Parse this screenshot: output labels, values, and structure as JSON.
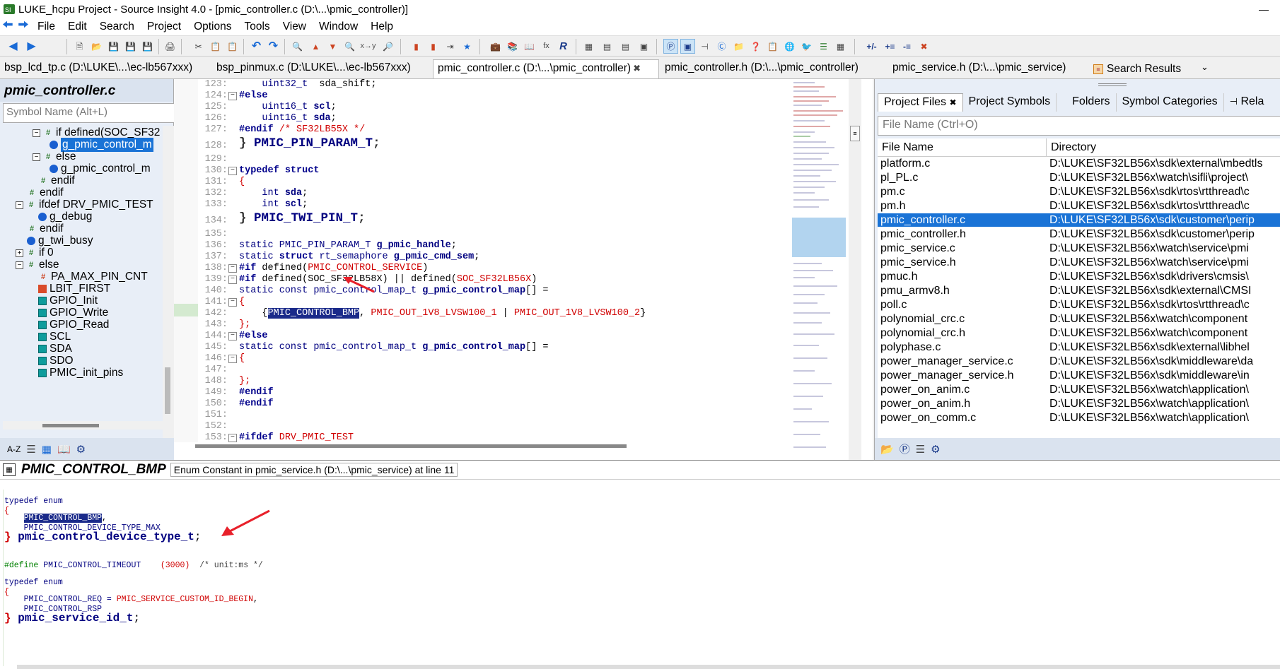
{
  "window": {
    "title": "LUKE_hcpu Project - Source Insight 4.0 - [pmic_controller.c (D:\\...\\pmic_controller)]",
    "minimize": "—"
  },
  "menu": [
    "File",
    "Edit",
    "Search",
    "Project",
    "Options",
    "Tools",
    "View",
    "Window",
    "Help"
  ],
  "file_tabs": [
    {
      "label": "bsp_lcd_tp.c (D:\\LUKE\\...\\ec-lb567xxx)"
    },
    {
      "label": "bsp_pinmux.c (D:\\LUKE\\...\\ec-lb567xxx)"
    },
    {
      "label": "pmic_controller.c (D:\\...\\pmic_controller)",
      "close": "✖"
    },
    {
      "label": "pmic_controller.h (D:\\...\\pmic_controller)"
    },
    {
      "label": "pmic_service.h (D:\\...\\pmic_service)"
    },
    {
      "label": "Search Results"
    }
  ],
  "symbol_panel": {
    "title": "pmic_controller.c",
    "search_placeholder": "Symbol Name (Alt+L)",
    "items": [
      {
        "label": "if defined(SOC_SF32"
      },
      {
        "label": "g_pmic_control_m"
      },
      {
        "label": "else"
      },
      {
        "label": "g_pmic_control_m"
      },
      {
        "label": "endif"
      },
      {
        "label": "endif"
      },
      {
        "label": "ifdef DRV_PMIC_TEST"
      },
      {
        "label": "g_debug"
      },
      {
        "label": "endif"
      },
      {
        "label": "g_twi_busy"
      },
      {
        "label": "if 0"
      },
      {
        "label": "else"
      },
      {
        "label": "PA_MAX_PIN_CNT"
      },
      {
        "label": "LBIT_FIRST"
      },
      {
        "label": "GPIO_Init"
      },
      {
        "label": "GPIO_Write"
      },
      {
        "label": "GPIO_Read"
      },
      {
        "label": "SCL"
      },
      {
        "label": "SDA"
      },
      {
        "label": "SDO"
      },
      {
        "label": "PMIC_init_pins"
      }
    ],
    "sort_label": "A-Z"
  },
  "code_lines": [
    {
      "num": "123:",
      "text": "    uint32_t  sda_shift;"
    },
    {
      "num": "124:",
      "text": "#else"
    },
    {
      "num": "125:",
      "text": "    uint16_t scl;"
    },
    {
      "num": "126:",
      "text": "    uint16_t sda;"
    },
    {
      "num": "127:",
      "text": "#endif /* SF32LB55X */"
    },
    {
      "num": "128:",
      "text": "} PMIC_PIN_PARAM_T;"
    },
    {
      "num": "129:",
      "text": ""
    },
    {
      "num": "130:",
      "text": "typedef struct"
    },
    {
      "num": "131:",
      "text": "{"
    },
    {
      "num": "132:",
      "text": "    int sda;"
    },
    {
      "num": "133:",
      "text": "    int scl;"
    },
    {
      "num": "134:",
      "text": "} PMIC_TWI_PIN_T;"
    },
    {
      "num": "135:",
      "text": ""
    },
    {
      "num": "136:",
      "text": "static PMIC_PIN_PARAM_T g_pmic_handle;"
    },
    {
      "num": "137:",
      "text": "static struct rt_semaphore g_pmic_cmd_sem;"
    },
    {
      "num": "138:",
      "text": "#if defined(PMIC_CONTROL_SERVICE)"
    },
    {
      "num": "139:",
      "text": "#if defined(SOC_SF32LB58X) || defined(SOC_SF32LB56X)"
    },
    {
      "num": "140:",
      "text": "static const pmic_control_map_t g_pmic_control_map[] ="
    },
    {
      "num": "141:",
      "text": "{"
    },
    {
      "num": "142:",
      "text": "    {PMIC_CONTROL_BMP, PMIC_OUT_1V8_LVSW100_1 | PMIC_OUT_1V8_LVSW100_2}"
    },
    {
      "num": "143:",
      "text": "};"
    },
    {
      "num": "144:",
      "text": "#else"
    },
    {
      "num": "145:",
      "text": "static const pmic_control_map_t g_pmic_control_map[] ="
    },
    {
      "num": "146:",
      "text": "{"
    },
    {
      "num": "147:",
      "text": ""
    },
    {
      "num": "148:",
      "text": "};"
    },
    {
      "num": "149:",
      "text": "#endif"
    },
    {
      "num": "150:",
      "text": "#endif"
    },
    {
      "num": "151:",
      "text": ""
    },
    {
      "num": "152:",
      "text": ""
    },
    {
      "num": "153:",
      "text": "#ifdef DRV_PMIC_TEST"
    }
  ],
  "code_tokens": {
    "l123a": "uint32_t",
    "l123b": "  sda_shift;",
    "l124": "#else",
    "l125a": "uint16_t",
    "l125b": "scl",
    "l125c": ";",
    "l126a": "uint16_t",
    "l126b": "sda",
    "l126c": ";",
    "l127a": "#endif",
    "l127b": "/* SF32LB55X */",
    "l128a": "}",
    "l128b": "PMIC_PIN_PARAM_T",
    "l128c": ";",
    "l130a": "typedef",
    "l130b": "struct",
    "l131": "{",
    "l132a": "int",
    "l132b": "sda",
    "l132c": ";",
    "l133a": "int",
    "l133b": "scl",
    "l133c": ";",
    "l134a": "}",
    "l134b": "PMIC_TWI_PIN_T",
    "l134c": ";",
    "l136a": "static",
    "l136b": "PMIC_PIN_PARAM_T",
    "l136c": "g_pmic_handle",
    "l136d": ";",
    "l137a": "static",
    "l137b": "struct",
    "l137c": "rt_semaphore",
    "l137d": "g_pmic_cmd_sem",
    "l137e": ";",
    "l138a": "#if",
    "l138b": "defined(",
    "l138c": "PMIC_CONTROL_SERVICE",
    "l138d": ")",
    "l139a": "#if",
    "l139b": "defined(SOC_SF32LB58X) || defined(",
    "l139c": "SOC_SF32LB56X",
    "l139d": ")",
    "l140a": "static const",
    "l140b": "pmic_control_map_t",
    "l140c": "g_pmic_control_map",
    "l140d": "[] =",
    "l141": "{",
    "l142a": "{",
    "l142b": "PMIC_CONTROL_BMP",
    "l142c": ", ",
    "l142d": "PMIC_OUT_1V8_LVSW100_1",
    "l142e": " | ",
    "l142f": "PMIC_OUT_1V8_LVSW100_2",
    "l142g": "}",
    "l143": "};",
    "l144": "#else",
    "l145a": "static const",
    "l145b": "pmic_control_map_t",
    "l145c": "g_pmic_control_map",
    "l145d": "[] =",
    "l146": "{",
    "l148": "};",
    "l149": "#endif",
    "l150": "#endif",
    "l153a": "#ifdef",
    "l153b": "DRV_PMIC_TEST"
  },
  "project_panel": {
    "tabs": [
      "Project Files",
      "Project Symbols",
      "Folders",
      "Symbol Categories",
      "Rela"
    ],
    "tab_close": "✖",
    "search_placeholder": "File Name (Ctrl+O)",
    "columns": [
      "File Name",
      "Directory"
    ],
    "files": [
      {
        "name": "platform.c",
        "dir": "D:\\LUKE\\SF32LB56x\\sdk\\external\\mbedtls"
      },
      {
        "name": "pl_PL.c",
        "dir": "D:\\LUKE\\SF32LB56x\\watch\\sifli\\project\\"
      },
      {
        "name": "pm.c",
        "dir": "D:\\LUKE\\SF32LB56x\\sdk\\rtos\\rtthread\\c"
      },
      {
        "name": "pm.h",
        "dir": "D:\\LUKE\\SF32LB56x\\sdk\\rtos\\rtthread\\c"
      },
      {
        "name": "pmic_controller.c",
        "dir": "D:\\LUKE\\SF32LB56x\\sdk\\customer\\perip"
      },
      {
        "name": "pmic_controller.h",
        "dir": "D:\\LUKE\\SF32LB56x\\sdk\\customer\\perip"
      },
      {
        "name": "pmic_service.c",
        "dir": "D:\\LUKE\\SF32LB56x\\watch\\service\\pmi"
      },
      {
        "name": "pmic_service.h",
        "dir": "D:\\LUKE\\SF32LB56x\\watch\\service\\pmi"
      },
      {
        "name": "pmuc.h",
        "dir": "D:\\LUKE\\SF32LB56x\\sdk\\drivers\\cmsis\\"
      },
      {
        "name": "pmu_armv8.h",
        "dir": "D:\\LUKE\\SF32LB56x\\sdk\\external\\CMSI"
      },
      {
        "name": "poll.c",
        "dir": "D:\\LUKE\\SF32LB56x\\sdk\\rtos\\rtthread\\c"
      },
      {
        "name": "polynomial_crc.c",
        "dir": "D:\\LUKE\\SF32LB56x\\watch\\component"
      },
      {
        "name": "polynomial_crc.h",
        "dir": "D:\\LUKE\\SF32LB56x\\watch\\component"
      },
      {
        "name": "polyphase.c",
        "dir": "D:\\LUKE\\SF32LB56x\\sdk\\external\\libhel"
      },
      {
        "name": "power_manager_service.c",
        "dir": "D:\\LUKE\\SF32LB56x\\sdk\\middleware\\da"
      },
      {
        "name": "power_manager_service.h",
        "dir": "D:\\LUKE\\SF32LB56x\\sdk\\middleware\\in"
      },
      {
        "name": "power_on_anim.c",
        "dir": "D:\\LUKE\\SF32LB56x\\watch\\application\\"
      },
      {
        "name": "power_on_anim.h",
        "dir": "D:\\LUKE\\SF32LB56x\\watch\\application\\"
      },
      {
        "name": "power_on_comm.c",
        "dir": "D:\\LUKE\\SF32LB56x\\watch\\application\\"
      }
    ]
  },
  "context": {
    "symbol": "PMIC_CONTROL_BMP",
    "description": "Enum Constant in pmic_service.h (D:\\...\\pmic_service) at line 11",
    "t": {
      "c1": "typedef enum",
      "c2": "{",
      "c3": "PMIC_CONTROL_BMP",
      "c3b": ",",
      "c4": "PMIC_CONTROL_DEVICE_TYPE_MAX",
      "c5a": "}",
      "c5b": "pmic_control_device_type_t",
      "c5c": ";",
      "c6a": "#define",
      "c6b": "PMIC_CONTROL_TIMEOUT",
      "c6c": "(3000)",
      "c6d": "/* unit:ms */",
      "c7": "typedef enum",
      "c8": "{",
      "c9a": "PMIC_CONTROL_REQ = ",
      "c9b": "PMIC_SERVICE_CUSTOM_ID_BEGIN",
      "c9c": ",",
      "c10": "PMIC_CONTROL_RSP",
      "c11a": "}",
      "c11b": "pmic_service_id_t",
      "c11c": ";"
    }
  },
  "colors": {
    "selection": "#1a73d6",
    "highlight": "#1a2a8a",
    "annotation_arrow": "#e8202a"
  }
}
